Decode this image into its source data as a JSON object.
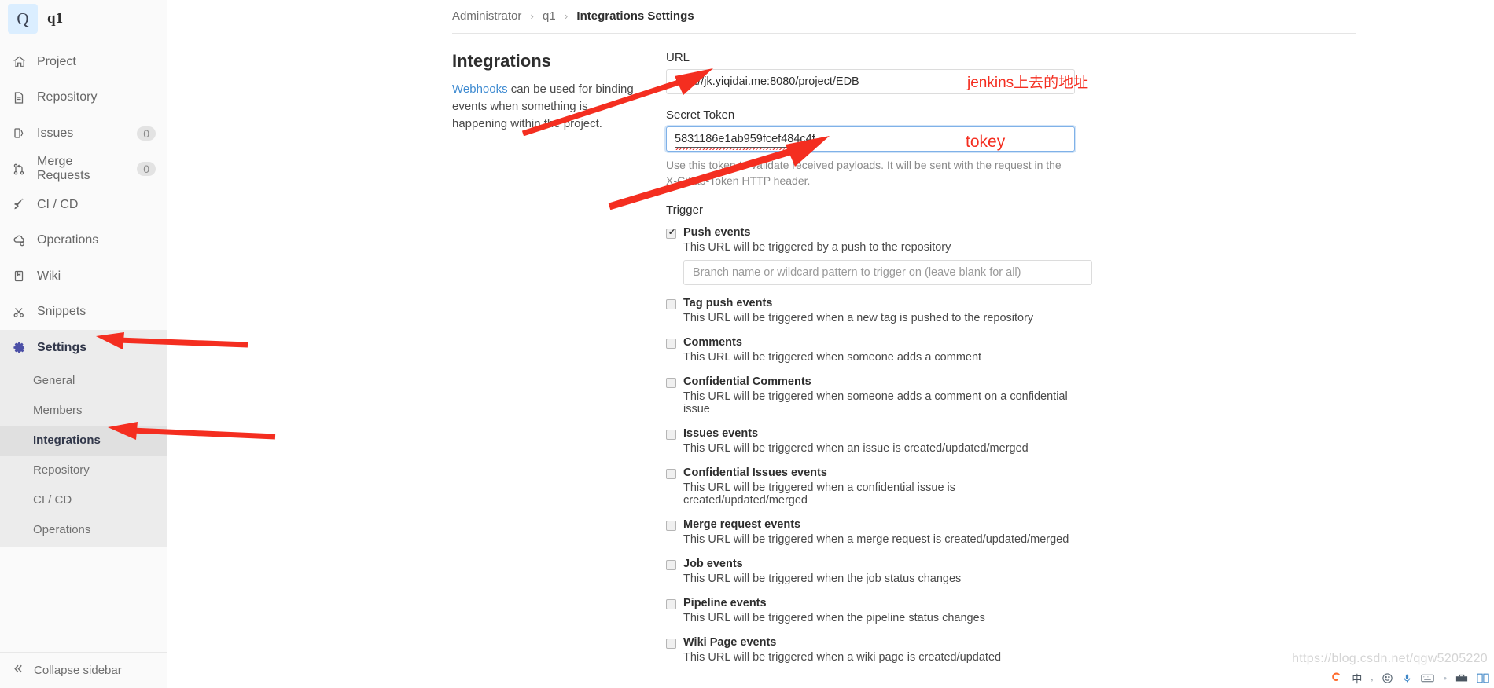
{
  "sidebar": {
    "project": {
      "avatar_letter": "Q",
      "name": "q1"
    },
    "items": [
      {
        "label": "Project",
        "icon": "home-icon",
        "badge": ""
      },
      {
        "label": "Repository",
        "icon": "file-icon",
        "badge": ""
      },
      {
        "label": "Issues",
        "icon": "issue-icon",
        "badge": "0"
      },
      {
        "label": "Merge Requests",
        "icon": "merge-icon",
        "badge": "0"
      },
      {
        "label": "CI / CD",
        "icon": "rocket-icon",
        "badge": ""
      },
      {
        "label": "Operations",
        "icon": "cloud-gear-icon",
        "badge": ""
      },
      {
        "label": "Wiki",
        "icon": "book-icon",
        "badge": ""
      },
      {
        "label": "Snippets",
        "icon": "scissors-icon",
        "badge": ""
      },
      {
        "label": "Settings",
        "icon": "gear-icon",
        "badge": ""
      }
    ],
    "subitems": [
      {
        "label": "General"
      },
      {
        "label": "Members"
      },
      {
        "label": "Integrations"
      },
      {
        "label": "Repository"
      },
      {
        "label": "CI / CD"
      },
      {
        "label": "Operations"
      }
    ],
    "collapse_label": "Collapse sidebar"
  },
  "breadcrumb": {
    "owner": "Administrator",
    "project": "q1",
    "current": "Integrations Settings",
    "separator": "›"
  },
  "intro": {
    "title": "Integrations",
    "link_text": "Webhooks",
    "description": " can be used for binding events when something is happening within the project."
  },
  "form": {
    "url_label": "URL",
    "url_value": "http://jk.yiqidai.me:8080/project/EDB",
    "token_label": "Secret Token",
    "token_value": "5831186e1ab959fcef484c4f",
    "token_help": "Use this token to validate received payloads. It will be sent with the request in the X-Gitlab-Token HTTP header.",
    "trigger_label": "Trigger",
    "branch_placeholder": "Branch name or wildcard pattern to trigger on (leave blank for all)"
  },
  "triggers": [
    {
      "name": "Push events",
      "desc": "This URL will be triggered by a push to the repository",
      "checked": true,
      "has_branch_input": true
    },
    {
      "name": "Tag push events",
      "desc": "This URL will be triggered when a new tag is pushed to the repository",
      "checked": false,
      "has_branch_input": false
    },
    {
      "name": "Comments",
      "desc": "This URL will be triggered when someone adds a comment",
      "checked": false,
      "has_branch_input": false
    },
    {
      "name": "Confidential Comments",
      "desc": "This URL will be triggered when someone adds a comment on a confidential issue",
      "checked": false,
      "has_branch_input": false
    },
    {
      "name": "Issues events",
      "desc": "This URL will be triggered when an issue is created/updated/merged",
      "checked": false,
      "has_branch_input": false
    },
    {
      "name": "Confidential Issues events",
      "desc": "This URL will be triggered when a confidential issue is created/updated/merged",
      "checked": false,
      "has_branch_input": false
    },
    {
      "name": "Merge request events",
      "desc": "This URL will be triggered when a merge request is created/updated/merged",
      "checked": false,
      "has_branch_input": false
    },
    {
      "name": "Job events",
      "desc": "This URL will be triggered when the job status changes",
      "checked": false,
      "has_branch_input": false
    },
    {
      "name": "Pipeline events",
      "desc": "This URL will be triggered when the pipeline status changes",
      "checked": false,
      "has_branch_input": false
    },
    {
      "name": "Wiki Page events",
      "desc": "This URL will be triggered when a wiki page is created/updated",
      "checked": false,
      "has_branch_input": false
    }
  ],
  "annotations": {
    "url_note": "jenkins上去的地址",
    "token_note": "tokey",
    "arrow_color": "#f42e20"
  },
  "watermark": {
    "text": "https://blog.csdn.net/qgw5205220"
  },
  "colors": {
    "accent": "#3f8bd1",
    "annotation_red": "#f42e20",
    "sidebar_bg": "#fafafa",
    "active_bg": "#e0e0e0"
  }
}
